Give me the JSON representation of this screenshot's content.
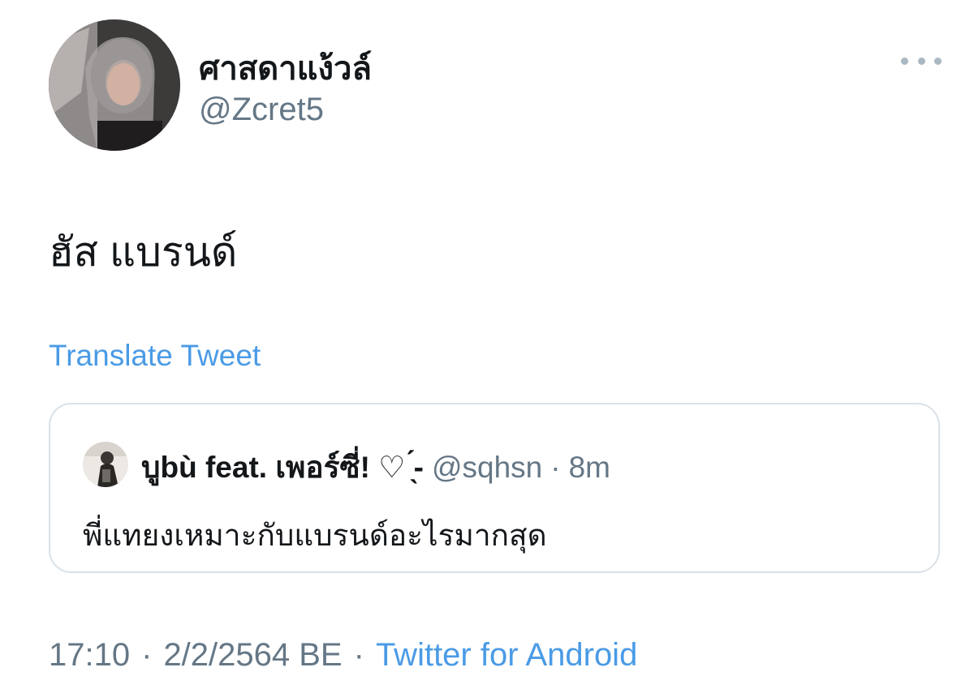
{
  "author": {
    "display_name": "ศาสดาแง้วล์",
    "handle": "@Zcret5",
    "avatar_icon": "profile-photo"
  },
  "more_menu": {
    "icon": "more-horizontal-icon"
  },
  "tweet": {
    "text": "ฮัส แบรนด์",
    "translate_label": "Translate Tweet"
  },
  "quoted_tweet": {
    "display_name": "บูbù feat. เพอร์ซี่! ♡ ̖́-",
    "handle": "@sqhsn",
    "separator": "·",
    "time": "8m",
    "text": "พี่แทยงเหมาะกับแบรนด์อะไรมากสุด"
  },
  "meta": {
    "time": "17:10",
    "sep1": "·",
    "date": "2/2/2564 BE",
    "sep2": "·",
    "source": "Twitter for Android"
  },
  "colors": {
    "link": "#4a9be6",
    "secondary_text": "#657786",
    "border": "#d9e1e8"
  }
}
